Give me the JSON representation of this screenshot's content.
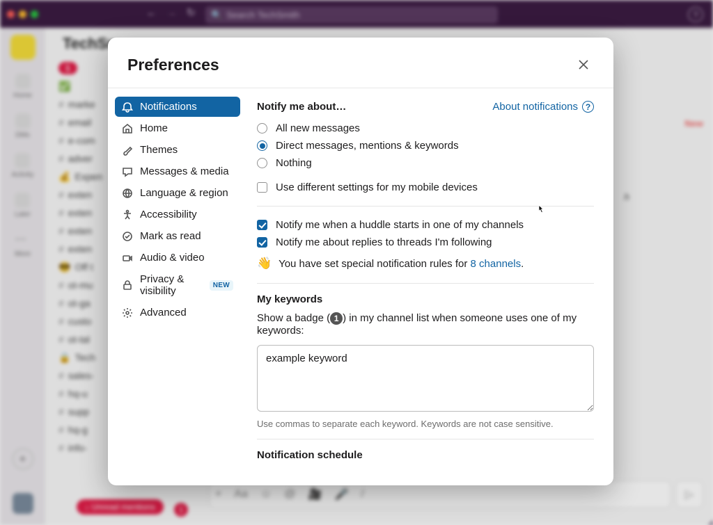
{
  "background": {
    "search_placeholder": "Search TechSmith",
    "workspace_label": "TechSm",
    "new_label": "New",
    "nav": [
      "Home",
      "DMs",
      "Activity",
      "Later",
      "More"
    ],
    "sidebar_rows": [
      {
        "t": "",
        "e": "✅"
      },
      {
        "t": "marke",
        "h": true
      },
      {
        "t": "email",
        "h": true
      },
      {
        "t": "e-com",
        "h": true
      },
      {
        "t": "adver",
        "h": true
      },
      {
        "t": "Expen",
        "e": "💰"
      },
      {
        "t": "exten",
        "h": true
      },
      {
        "t": "exten",
        "h": true
      },
      {
        "t": "exten",
        "h": true
      },
      {
        "t": "exten",
        "h": true
      },
      {
        "t": "Off t",
        "e": "😎"
      },
      {
        "t": "ot-mu",
        "h": true
      },
      {
        "t": "ot-ga",
        "h": true
      },
      {
        "t": "custo",
        "h": true
      },
      {
        "t": "ot-tal",
        "h": true
      },
      {
        "t": "Tech",
        "e": "🔒"
      },
      {
        "t": "sales-",
        "h": true
      },
      {
        "t": "hq-u",
        "h": true
      },
      {
        "t": "supp",
        "h": true
      },
      {
        "t": "hq-g",
        "h": true
      },
      {
        "t": "info-",
        "h": true
      }
    ],
    "unread_label": "Unread mentions"
  },
  "modal": {
    "title": "Preferences",
    "sidebar": [
      {
        "key": "notifications",
        "label": "Notifications",
        "icon": "bell",
        "active": true
      },
      {
        "key": "home",
        "label": "Home",
        "icon": "home"
      },
      {
        "key": "themes",
        "label": "Themes",
        "icon": "brush"
      },
      {
        "key": "messages",
        "label": "Messages & media",
        "icon": "chat"
      },
      {
        "key": "language",
        "label": "Language & region",
        "icon": "globe"
      },
      {
        "key": "accessibility",
        "label": "Accessibility",
        "icon": "access"
      },
      {
        "key": "markasread",
        "label": "Mark as read",
        "icon": "check"
      },
      {
        "key": "audiovideo",
        "label": "Audio & video",
        "icon": "video"
      },
      {
        "key": "privacy",
        "label": "Privacy & visibility",
        "icon": "lock",
        "badge": "NEW"
      },
      {
        "key": "advanced",
        "label": "Advanced",
        "icon": "gear"
      }
    ],
    "notify_heading": "Notify me about…",
    "about_link": "About notifications",
    "radios": [
      {
        "label": "All new messages",
        "selected": false
      },
      {
        "label": "Direct messages, mentions & keywords",
        "selected": true
      },
      {
        "label": "Nothing",
        "selected": false
      }
    ],
    "mobile_check": {
      "label": "Use different settings for my mobile devices",
      "checked": false
    },
    "huddle_check": {
      "label": "Notify me when a huddle starts in one of my channels",
      "checked": true
    },
    "thread_check": {
      "label": "Notify me about replies to threads I'm following",
      "checked": true
    },
    "special_text_pre": "You have set special notification rules for ",
    "special_link": "8 channels",
    "special_text_post": ".",
    "keywords_heading": "My keywords",
    "keywords_desc_pre": "Show a badge (",
    "keywords_badge": "1",
    "keywords_desc_post": ") in my channel list when someone uses one of my keywords:",
    "keywords_value": "example keyword",
    "keywords_hint": "Use commas to separate each keyword. Keywords are not case sensitive.",
    "schedule_heading": "Notification schedule"
  }
}
